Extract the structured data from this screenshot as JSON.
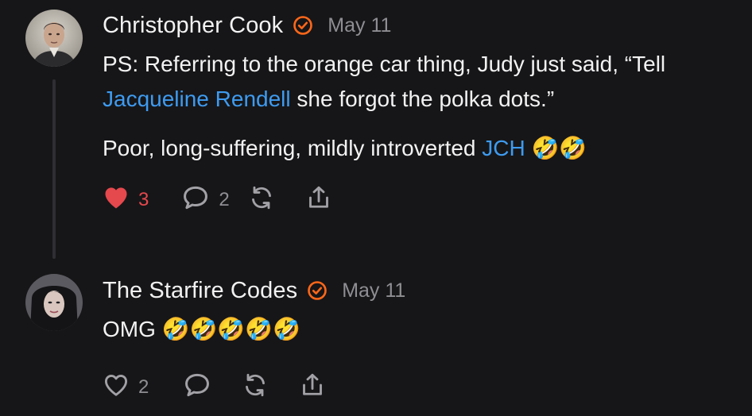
{
  "posts": [
    {
      "author": "Christopher Cook",
      "verified": true,
      "date": "May 11",
      "body": {
        "p1_a": "PS: Referring to the orange car thing, Judy just said, “Tell ",
        "p1_mention": "Jacqueline Rendell",
        "p1_b": " she forgot the polka dots.”",
        "p2_a": "Poor, long-suffering, mildly introverted ",
        "p2_mention": "JCH",
        "p2_emoji": "🤣🤣"
      },
      "likes": "3",
      "liked": true,
      "comments": "2",
      "icons": [
        "heart-filled-icon",
        "comment-bubble-icon",
        "restack-icon",
        "share-icon"
      ]
    },
    {
      "author": "The Starfire Codes",
      "verified": true,
      "date": "May 11",
      "body": {
        "text": "OMG ",
        "emoji": "🤣🤣🤣🤣🤣"
      },
      "likes": "2",
      "liked": false,
      "icons": [
        "heart-outline-icon",
        "comment-bubble-icon",
        "restack-icon",
        "share-icon"
      ]
    }
  ],
  "colors": {
    "background": "#161618",
    "text": "#f2f2f3",
    "muted": "#8e8e93",
    "mention": "#3e9bf0",
    "verified": "#ff6719",
    "like": "#e5484d",
    "thread_line": "#2f2f33"
  }
}
